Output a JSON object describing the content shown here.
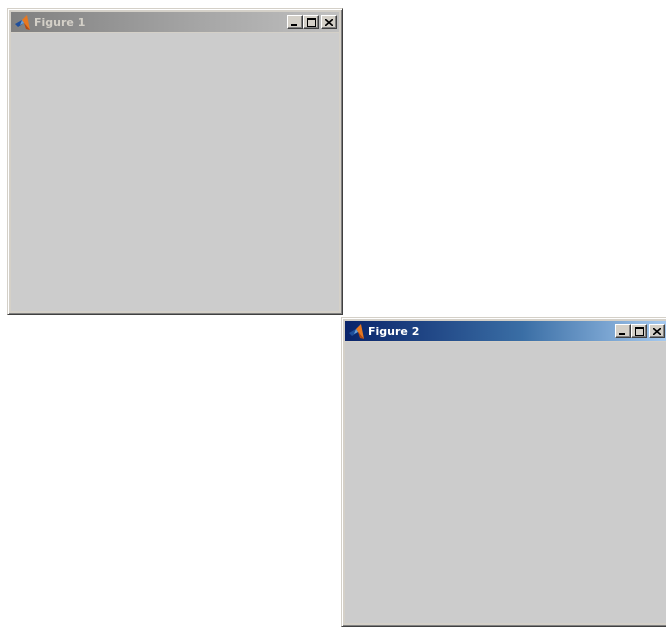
{
  "windows": [
    {
      "title": "Figure 1",
      "active": false,
      "icon": "matlab-logo-icon",
      "controls": [
        "minimize-icon",
        "maximize-icon",
        "close-icon"
      ]
    },
    {
      "title": "Figure 2",
      "active": true,
      "icon": "matlab-logo-icon",
      "controls": [
        "minimize-icon",
        "maximize-icon",
        "close-icon"
      ]
    }
  ],
  "colors": {
    "desktop": "#ffffff",
    "client_area": "#cccccc",
    "active_title_start": "#0a246a",
    "active_title_end": "#a6caf0",
    "inactive_title_start": "#808080",
    "inactive_title_end": "#c0c0c0"
  }
}
